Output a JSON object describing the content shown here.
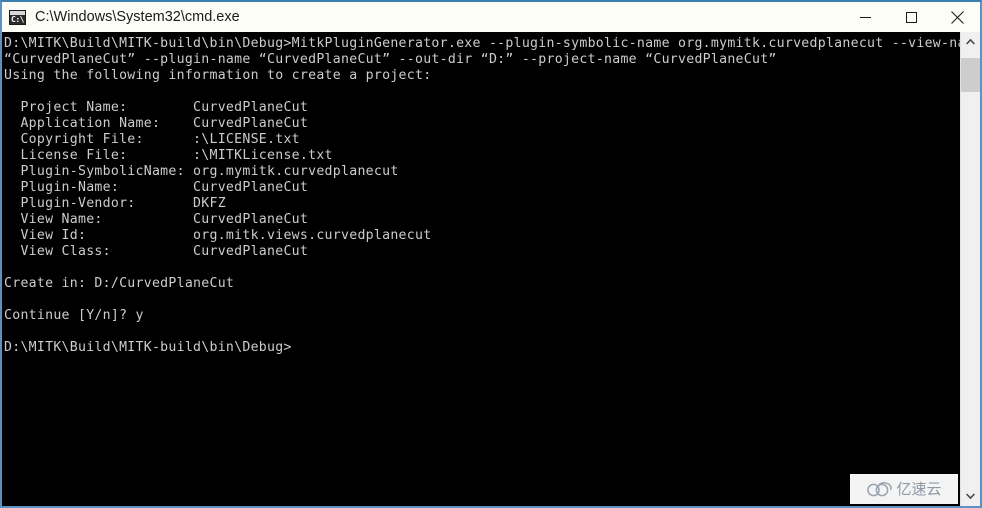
{
  "window": {
    "title": "C:\\Windows\\System32\\cmd.exe",
    "icon_name": "cmd-icon",
    "icon_glyph": "C:\\",
    "controls": {
      "minimize_label": "Minimize",
      "maximize_label": "Maximize",
      "close_label": "Close"
    },
    "border_color": "#5b92c4",
    "titlebar_bg": "#fdfdf8"
  },
  "console": {
    "background": "#000000",
    "foreground": "#cccccc",
    "text": "D:\\MITK\\Build\\MITK-build\\bin\\Debug>MitkPluginGenerator.exe --plugin-symbolic-name org.mymitk.curvedplanecut --view-name\n“CurvedPlaneCut” --plugin-name “CurvedPlaneCut” --out-dir “D:” --project-name “CurvedPlaneCut”\nUsing the following information to create a project:\n\n  Project Name:        CurvedPlaneCut\n  Application Name:    CurvedPlaneCut\n  Copyright File:      :\\LICENSE.txt\n  License File:        :\\MITKLicense.txt\n  Plugin-SymbolicName: org.mymitk.curvedplanecut\n  Plugin-Name:         CurvedPlaneCut\n  Plugin-Vendor:       DKFZ\n  View Name:           CurvedPlaneCut\n  View Id:             org.mitk.views.curvedplanecut\n  View Class:          CurvedPlaneCut\n\nCreate in: D:/CurvedPlaneCut\n\nContinue [Y/n]? y\n\nD:\\MITK\\Build\\MITK-build\\bin\\Debug>",
    "command_line": "D:\\MITK\\Build\\MITK-build\\bin\\Debug>MitkPluginGenerator.exe --plugin-symbolic-name org.mymitk.curvedplanecut --view-name “CurvedPlaneCut” --plugin-name “CurvedPlaneCut” --out-dir “D:” --project-name “CurvedPlaneCut”",
    "info_heading": "Using the following information to create a project:",
    "info_fields": [
      {
        "label": "Project Name:",
        "value": "CurvedPlaneCut"
      },
      {
        "label": "Application Name:",
        "value": "CurvedPlaneCut"
      },
      {
        "label": "Copyright File:",
        "value": ":\\LICENSE.txt"
      },
      {
        "label": "License File:",
        "value": ":\\MITKLicense.txt"
      },
      {
        "label": "Plugin-SymbolicName:",
        "value": "org.mymitk.curvedplanecut"
      },
      {
        "label": "Plugin-Name:",
        "value": "CurvedPlaneCut"
      },
      {
        "label": "Plugin-Vendor:",
        "value": "DKFZ"
      },
      {
        "label": "View Name:",
        "value": "CurvedPlaneCut"
      },
      {
        "label": "View Id:",
        "value": "org.mitk.views.curvedplanecut"
      },
      {
        "label": "View Class:",
        "value": "CurvedPlaneCut"
      }
    ],
    "create_in": "Create in: D:/CurvedPlaneCut",
    "prompt_question": "Continue [Y/n]? y",
    "final_prompt": "D:\\MITK\\Build\\MITK-build\\bin\\Debug>"
  },
  "scrollbar": {
    "up_arrow": "scroll-up-arrow-icon",
    "down_arrow": "scroll-down-arrow-icon",
    "thumb_color": "#cdcdcd",
    "track_color": "#f0f0f0"
  },
  "watermark": {
    "text": "亿速云",
    "logo_name": "cloud-logo-icon",
    "color": "#8d98a6"
  }
}
